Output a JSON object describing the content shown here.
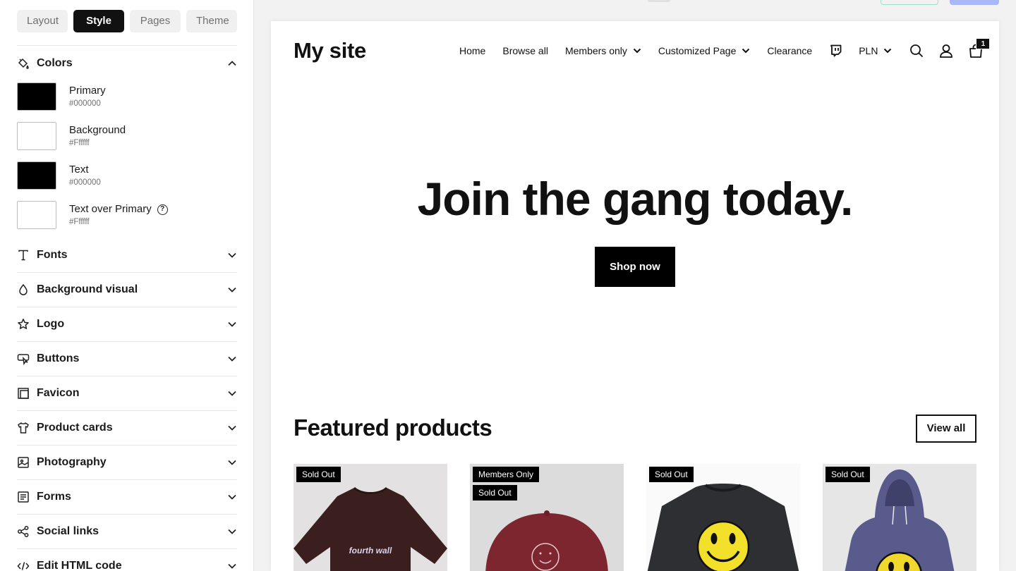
{
  "sidebar": {
    "tabs": [
      {
        "label": "Layout"
      },
      {
        "label": "Style",
        "active": true
      },
      {
        "label": "Pages"
      },
      {
        "label": "Theme"
      }
    ],
    "colors": {
      "title": "Colors",
      "items": [
        {
          "name": "Primary",
          "hex": "#000000",
          "swatch": "#000000"
        },
        {
          "name": "Background",
          "hex": "#Ffffff",
          "swatch": "#ffffff"
        },
        {
          "name": "Text",
          "hex": "#000000",
          "swatch": "#000000"
        },
        {
          "name": "Text over Primary",
          "hex": "#Ffffff",
          "swatch": "#ffffff"
        }
      ]
    },
    "sections": [
      {
        "label": "Fonts",
        "icon": "type-icon"
      },
      {
        "label": "Background visual",
        "icon": "droplet-icon"
      },
      {
        "label": "Logo",
        "icon": "star-icon"
      },
      {
        "label": "Buttons",
        "icon": "pointer-button-icon"
      },
      {
        "label": "Favicon",
        "icon": "favicon-icon"
      },
      {
        "label": "Product cards",
        "icon": "shirt-icon"
      },
      {
        "label": "Photography",
        "icon": "image-icon"
      },
      {
        "label": "Forms",
        "icon": "form-icon"
      },
      {
        "label": "Social links",
        "icon": "share-icon"
      },
      {
        "label": "Edit HTML code",
        "icon": "code-icon"
      }
    ]
  },
  "preview": {
    "site_title": "My site",
    "nav": {
      "home": "Home",
      "browse": "Browse all",
      "members": "Members only",
      "custom": "Customized Page",
      "clearance": "Clearance",
      "currency": "PLN",
      "cart_count": "1"
    },
    "hero": {
      "title": "Join the gang today.",
      "button": "Shop now"
    },
    "featured": {
      "title": "Featured products",
      "view_all": "View all",
      "products": [
        {
          "badges": [
            "Sold Out"
          ],
          "image": "brown-tshirt",
          "print": "fourth wall"
        },
        {
          "badges": [
            "Members Only",
            "Sold Out"
          ],
          "image": "red-cap"
        },
        {
          "badges": [
            "Sold Out"
          ],
          "image": "black-smiley-sweatshirt"
        },
        {
          "badges": [
            "Sold Out"
          ],
          "image": "blue-smiley-hoodie"
        }
      ]
    }
  }
}
